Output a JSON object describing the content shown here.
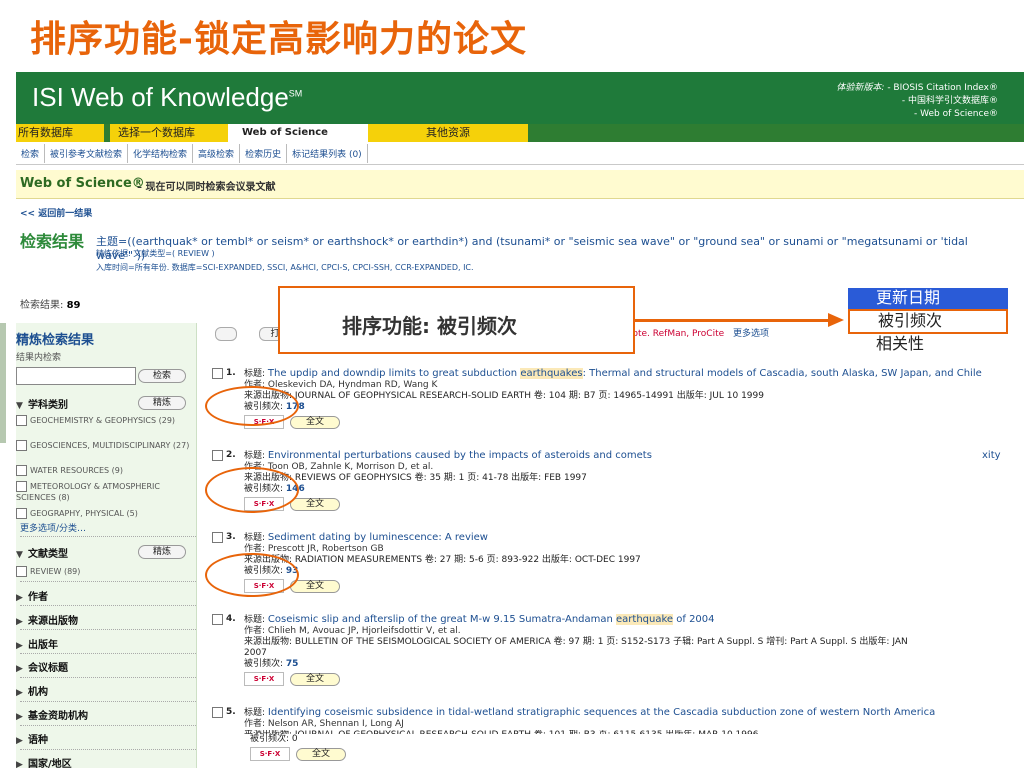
{
  "slide_title": "排序功能-锁定高影响力的论文",
  "header": {
    "logo": "ISI Web of Knowledge",
    "logo_sup": "SM",
    "edition_label": "体验新版本:",
    "edition_lines": [
      "- BIOSIS Citation Index®",
      "- 中国科学引文数据库®",
      "- Web of Science®"
    ]
  },
  "tabs": [
    "所有数据库",
    "选择一个数据库",
    "Web of Science",
    "其他资源"
  ],
  "toolbar": [
    "检索",
    "被引参考文献检索",
    "化学结构检索",
    "高级检索",
    "检索历史",
    "标记结果列表 (0)"
  ],
  "wos_bar": {
    "title": "Web of Science®",
    "subtitle": "– 现在可以同时检索会议录文献"
  },
  "back_link": "<< 返回前一结果",
  "results": {
    "title": "检索结果",
    "query": "主题=((earthquak* or tembl* or seism* or earthshock* or earthdin*) and (tsunami* or \"seismic sea wave\" or \"ground sea\" or sunami or \"megatsunami or 'tidal wave'\" ))",
    "refine_basis": "精炼依据: 文献类型=( REVIEW )",
    "timespan": "入库时间=所有年份. 数据库=SCI-EXPANDED, SSCI, A&HCI, CPCI-S, CPCI-SSH, CCR-EXPANDED, IC.",
    "hits_label": "检索结果:",
    "hits": "89"
  },
  "callout": "排序功能: 被引频次",
  "sort_options": [
    "更新日期",
    "被引频次",
    "相关性"
  ],
  "sortbar": {
    "print_label": "打",
    "export": "dNote",
    "export2": "RefMan, ProCite",
    "more": "更多选项"
  },
  "sidebar": {
    "title": "精炼检索结果",
    "within": "结果内检索",
    "search_btn": "检索",
    "refine_btn": "精炼",
    "subject_section": "学科类别",
    "subjects": [
      "GEOCHEMISTRY & GEOPHYSICS (29)",
      "GEOSCIENCES, MULTIDISCIPLINARY (27)",
      "WATER RESOURCES (9)",
      "METEOROLOGY & ATMOSPHERIC SCIENCES (8)",
      "GEOGRAPHY, PHYSICAL (5)"
    ],
    "more": "更多选项/分类…",
    "doctype_section": "文献类型",
    "doctype_item": "REVIEW (89)",
    "sections": [
      "作者",
      "来源出版物",
      "出版年",
      "会议标题",
      "机构",
      "基金资助机构",
      "语种",
      "国家/地区"
    ]
  },
  "records": [
    {
      "num": "1.",
      "title_label": "标题:",
      "title_pre": "The updip and downdip limits to great subduction ",
      "title_hl": "earthquakes",
      "title_post": ": Thermal and structural models of Cascadia, south Alaska, SW Japan, and Chile",
      "authors": "作者: Oleskevich DA, Hyndman RD, Wang K",
      "source": "来源出版物: JOURNAL OF GEOPHYSICAL RESEARCH-SOLID EARTH   卷: 104   期: B7   页: 14965-14991   出版年: JUL 10 1999",
      "source2": "",
      "cite_label": "被引频次:",
      "cites": "178"
    },
    {
      "num": "2.",
      "title_label": "标题:",
      "title_pre": "Environmental perturbations caused by the impacts of asteroids and comets",
      "title_hl": "",
      "title_post": "",
      "authors": "作者: Toon OB, Zahnle K, Morrison D, et al.",
      "source": "来源出版物: REVIEWS OF GEOPHYSICS   卷: 35   期: 1   页: 41-78   出版年: FEB 1997",
      "source2": "",
      "cite_label": "被引频次:",
      "cites": "146"
    },
    {
      "num": "3.",
      "title_label": "标题:",
      "title_pre": "Sediment dating by luminescence: A review",
      "title_hl": "",
      "title_post": "",
      "authors": "作者: Prescott JR, Robertson GB",
      "source": "来源出版物: RADIATION MEASUREMENTS   卷: 27   期: 5-6   页: 893-922   出版年: OCT-DEC 1997",
      "source2": "",
      "cite_label": "被引频次:",
      "cites": "93"
    },
    {
      "num": "4.",
      "title_label": "标题:",
      "title_pre": "Coseismic slip and afterslip of the great M-w 9.15 Sumatra-Andaman ",
      "title_hl": "earthquake",
      "title_post": " of 2004",
      "authors": "作者: Chlieh M, Avouac JP, Hjorleifsdottir V, et al.",
      "source": "来源出版物: BULLETIN OF THE SEISMOLOGICAL SOCIETY OF AMERICA   卷: 97   期: 1   页: S152-S173   子辑: Part A Suppl. S   增刊: Part A Suppl. S   出版年: JAN",
      "source2": "2007",
      "cite_label": "被引频次:",
      "cites": "75"
    },
    {
      "num": "5.",
      "title_label": "标题:",
      "title_pre": "Identifying coseismic subsidence in tidal-wetland stratigraphic sequences at the Cascadia subduction zone of western North America",
      "title_hl": "",
      "title_post": "",
      "authors": "作者: Nelson AR, Shennan I, Long AJ",
      "source": "来源出版物: JOURNAL OF GEOPHYSICAL RESEARCH-SOLID EARTH   卷: 101   期: B3   页: 6115-6135   出版年: MAR 10 1996",
      "source2": "",
      "cite_label": "被引频次:",
      "cites": "0"
    }
  ],
  "sfx_label": "S·F·X",
  "fulltext_label": "全文",
  "xity": "xity"
}
